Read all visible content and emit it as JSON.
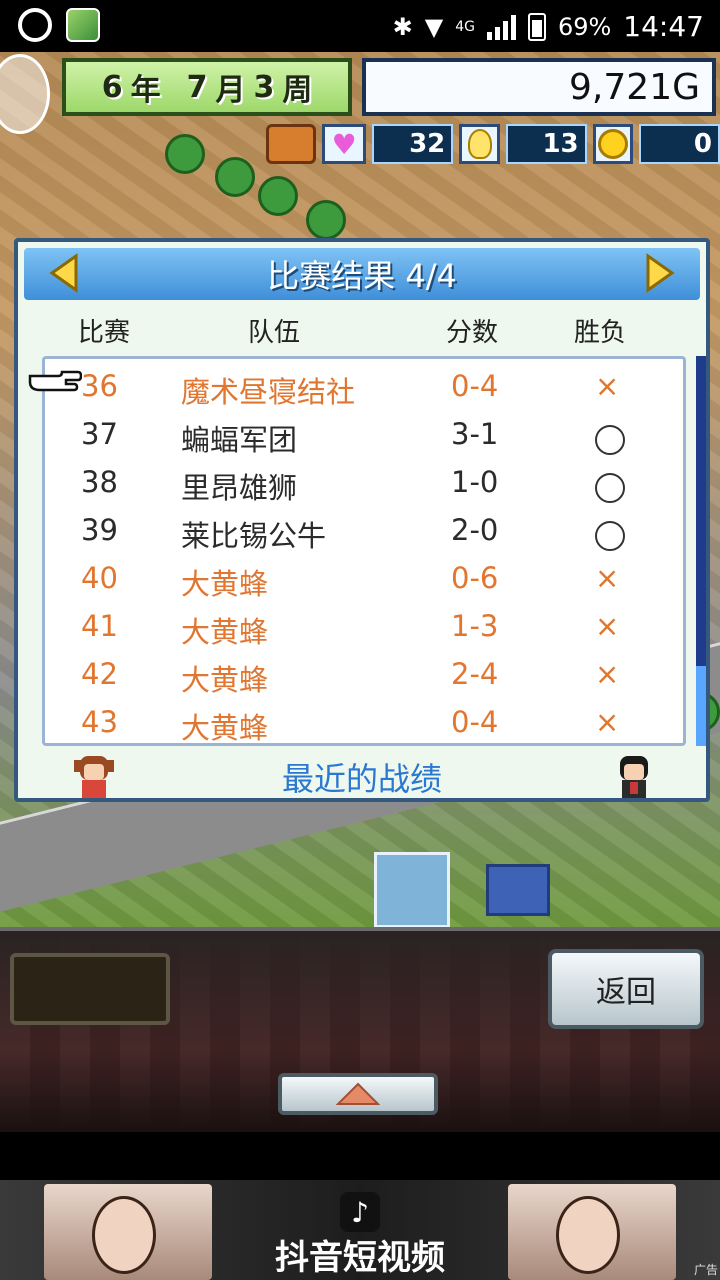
{
  "status_bar": {
    "network": "4G",
    "battery": "69%",
    "time": "14:47"
  },
  "hud": {
    "year_num": "6",
    "year_unit": "年",
    "month_num": "7",
    "month_unit": "月",
    "week_num": "3",
    "week_unit": "周",
    "money": "9,721G",
    "hearts_count": "32",
    "ideas_count": "13",
    "coins_count": "0"
  },
  "results_panel": {
    "title": "比赛结果 4/4",
    "columns": {
      "match": "比赛",
      "team": "队伍",
      "score": "分数",
      "result": "胜负"
    },
    "rows": [
      {
        "match": "36",
        "team": "魔术昼寝结社",
        "score": "0-4",
        "result": "×",
        "outcome": "loss"
      },
      {
        "match": "37",
        "team": "蝙蝠军团",
        "score": "3-1",
        "result": "○",
        "outcome": "win"
      },
      {
        "match": "38",
        "team": "里昂雄狮",
        "score": "1-0",
        "result": "○",
        "outcome": "win"
      },
      {
        "match": "39",
        "team": "莱比锡公牛",
        "score": "2-0",
        "result": "○",
        "outcome": "win"
      },
      {
        "match": "40",
        "team": "大黄蜂",
        "score": "0-6",
        "result": "×",
        "outcome": "loss"
      },
      {
        "match": "41",
        "team": "大黄蜂",
        "score": "1-3",
        "result": "×",
        "outcome": "loss"
      },
      {
        "match": "42",
        "team": "大黄蜂",
        "score": "2-4",
        "result": "×",
        "outcome": "loss"
      },
      {
        "match": "43",
        "team": "大黄蜂",
        "score": "0-4",
        "result": "×",
        "outcome": "loss"
      }
    ],
    "footer": "最近的战绩"
  },
  "bottom_bar": {
    "back_label": "返回"
  },
  "ad": {
    "text": "抖音短视频",
    "tag": "广告"
  },
  "colors": {
    "loss": "#e0762f",
    "win": "#2b2b2b",
    "header": "#3f8fd8",
    "footer_text": "#2a78d0"
  }
}
